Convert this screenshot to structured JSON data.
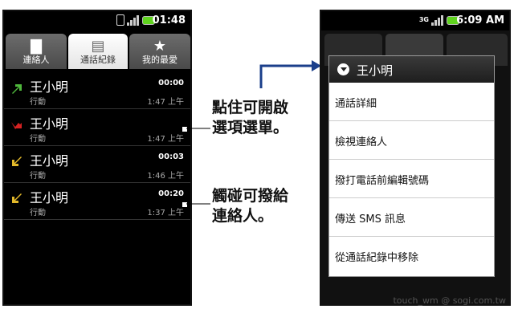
{
  "left_phone": {
    "status": {
      "time": "01:48"
    },
    "tabs": [
      {
        "label": "連絡人",
        "icon": "folder-icon"
      },
      {
        "label": "通話紀錄",
        "icon": "call-log-icon"
      },
      {
        "label": "我的最愛",
        "icon": "star-icon"
      }
    ],
    "calls": [
      {
        "name": "王小明",
        "type": "行動",
        "duration": "00:00",
        "time": "1:47 上午",
        "kind": "outgoing",
        "color": "#4fb83c"
      },
      {
        "name": "王小明",
        "type": "行動",
        "duration": "",
        "time": "1:47 上午",
        "kind": "missed",
        "color": "#d62222"
      },
      {
        "name": "王小明",
        "type": "行動",
        "duration": "00:03",
        "time": "1:46 上午",
        "kind": "incoming",
        "color": "#e2b82a"
      },
      {
        "name": "王小明",
        "type": "行動",
        "duration": "00:20",
        "time": "1:37 上午",
        "kind": "incoming",
        "color": "#e2b82a"
      }
    ]
  },
  "annotations": {
    "long_press": [
      "點住可開啟",
      "選項選單。"
    ],
    "tap": [
      "觸碰可撥給",
      "連絡人。"
    ]
  },
  "right_phone": {
    "status": {
      "time": "6:09 AM",
      "network": "3G"
    },
    "menu": {
      "title": "王小明",
      "items": [
        "通話詳細",
        "檢視連絡人",
        "撥打電話前編輯號碼",
        "傳送 SMS 訊息",
        "從通話紀錄中移除"
      ]
    }
  },
  "watermark": "touch_wm  @ sogi.com.tw"
}
